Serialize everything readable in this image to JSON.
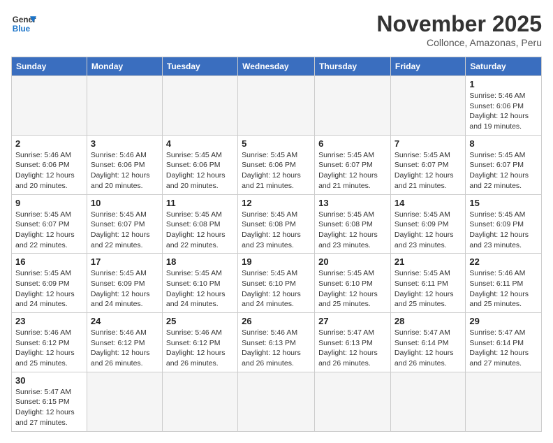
{
  "header": {
    "logo_general": "General",
    "logo_blue": "Blue",
    "title": "November 2025",
    "subtitle": "Collonce, Amazonas, Peru"
  },
  "calendar": {
    "days_of_week": [
      "Sunday",
      "Monday",
      "Tuesday",
      "Wednesday",
      "Thursday",
      "Friday",
      "Saturday"
    ],
    "weeks": [
      [
        {
          "day": "",
          "info": "",
          "empty": true
        },
        {
          "day": "",
          "info": "",
          "empty": true
        },
        {
          "day": "",
          "info": "",
          "empty": true
        },
        {
          "day": "",
          "info": "",
          "empty": true
        },
        {
          "day": "",
          "info": "",
          "empty": true
        },
        {
          "day": "",
          "info": "",
          "empty": true
        },
        {
          "day": "1",
          "info": "Sunrise: 5:46 AM\nSunset: 6:06 PM\nDaylight: 12 hours and 19 minutes."
        }
      ],
      [
        {
          "day": "2",
          "info": "Sunrise: 5:46 AM\nSunset: 6:06 PM\nDaylight: 12 hours and 20 minutes."
        },
        {
          "day": "3",
          "info": "Sunrise: 5:46 AM\nSunset: 6:06 PM\nDaylight: 12 hours and 20 minutes."
        },
        {
          "day": "4",
          "info": "Sunrise: 5:45 AM\nSunset: 6:06 PM\nDaylight: 12 hours and 20 minutes."
        },
        {
          "day": "5",
          "info": "Sunrise: 5:45 AM\nSunset: 6:06 PM\nDaylight: 12 hours and 21 minutes."
        },
        {
          "day": "6",
          "info": "Sunrise: 5:45 AM\nSunset: 6:07 PM\nDaylight: 12 hours and 21 minutes."
        },
        {
          "day": "7",
          "info": "Sunrise: 5:45 AM\nSunset: 6:07 PM\nDaylight: 12 hours and 21 minutes."
        },
        {
          "day": "8",
          "info": "Sunrise: 5:45 AM\nSunset: 6:07 PM\nDaylight: 12 hours and 22 minutes."
        }
      ],
      [
        {
          "day": "9",
          "info": "Sunrise: 5:45 AM\nSunset: 6:07 PM\nDaylight: 12 hours and 22 minutes."
        },
        {
          "day": "10",
          "info": "Sunrise: 5:45 AM\nSunset: 6:07 PM\nDaylight: 12 hours and 22 minutes."
        },
        {
          "day": "11",
          "info": "Sunrise: 5:45 AM\nSunset: 6:08 PM\nDaylight: 12 hours and 22 minutes."
        },
        {
          "day": "12",
          "info": "Sunrise: 5:45 AM\nSunset: 6:08 PM\nDaylight: 12 hours and 23 minutes."
        },
        {
          "day": "13",
          "info": "Sunrise: 5:45 AM\nSunset: 6:08 PM\nDaylight: 12 hours and 23 minutes."
        },
        {
          "day": "14",
          "info": "Sunrise: 5:45 AM\nSunset: 6:09 PM\nDaylight: 12 hours and 23 minutes."
        },
        {
          "day": "15",
          "info": "Sunrise: 5:45 AM\nSunset: 6:09 PM\nDaylight: 12 hours and 23 minutes."
        }
      ],
      [
        {
          "day": "16",
          "info": "Sunrise: 5:45 AM\nSunset: 6:09 PM\nDaylight: 12 hours and 24 minutes."
        },
        {
          "day": "17",
          "info": "Sunrise: 5:45 AM\nSunset: 6:09 PM\nDaylight: 12 hours and 24 minutes."
        },
        {
          "day": "18",
          "info": "Sunrise: 5:45 AM\nSunset: 6:10 PM\nDaylight: 12 hours and 24 minutes."
        },
        {
          "day": "19",
          "info": "Sunrise: 5:45 AM\nSunset: 6:10 PM\nDaylight: 12 hours and 24 minutes."
        },
        {
          "day": "20",
          "info": "Sunrise: 5:45 AM\nSunset: 6:10 PM\nDaylight: 12 hours and 25 minutes."
        },
        {
          "day": "21",
          "info": "Sunrise: 5:45 AM\nSunset: 6:11 PM\nDaylight: 12 hours and 25 minutes."
        },
        {
          "day": "22",
          "info": "Sunrise: 5:46 AM\nSunset: 6:11 PM\nDaylight: 12 hours and 25 minutes."
        }
      ],
      [
        {
          "day": "23",
          "info": "Sunrise: 5:46 AM\nSunset: 6:12 PM\nDaylight: 12 hours and 25 minutes."
        },
        {
          "day": "24",
          "info": "Sunrise: 5:46 AM\nSunset: 6:12 PM\nDaylight: 12 hours and 26 minutes."
        },
        {
          "day": "25",
          "info": "Sunrise: 5:46 AM\nSunset: 6:12 PM\nDaylight: 12 hours and 26 minutes."
        },
        {
          "day": "26",
          "info": "Sunrise: 5:46 AM\nSunset: 6:13 PM\nDaylight: 12 hours and 26 minutes."
        },
        {
          "day": "27",
          "info": "Sunrise: 5:47 AM\nSunset: 6:13 PM\nDaylight: 12 hours and 26 minutes."
        },
        {
          "day": "28",
          "info": "Sunrise: 5:47 AM\nSunset: 6:14 PM\nDaylight: 12 hours and 26 minutes."
        },
        {
          "day": "29",
          "info": "Sunrise: 5:47 AM\nSunset: 6:14 PM\nDaylight: 12 hours and 27 minutes."
        }
      ],
      [
        {
          "day": "30",
          "info": "Sunrise: 5:47 AM\nSunset: 6:15 PM\nDaylight: 12 hours and 27 minutes."
        },
        {
          "day": "",
          "info": "",
          "empty": true
        },
        {
          "day": "",
          "info": "",
          "empty": true
        },
        {
          "day": "",
          "info": "",
          "empty": true
        },
        {
          "day": "",
          "info": "",
          "empty": true
        },
        {
          "day": "",
          "info": "",
          "empty": true
        },
        {
          "day": "",
          "info": "",
          "empty": true
        }
      ]
    ]
  }
}
